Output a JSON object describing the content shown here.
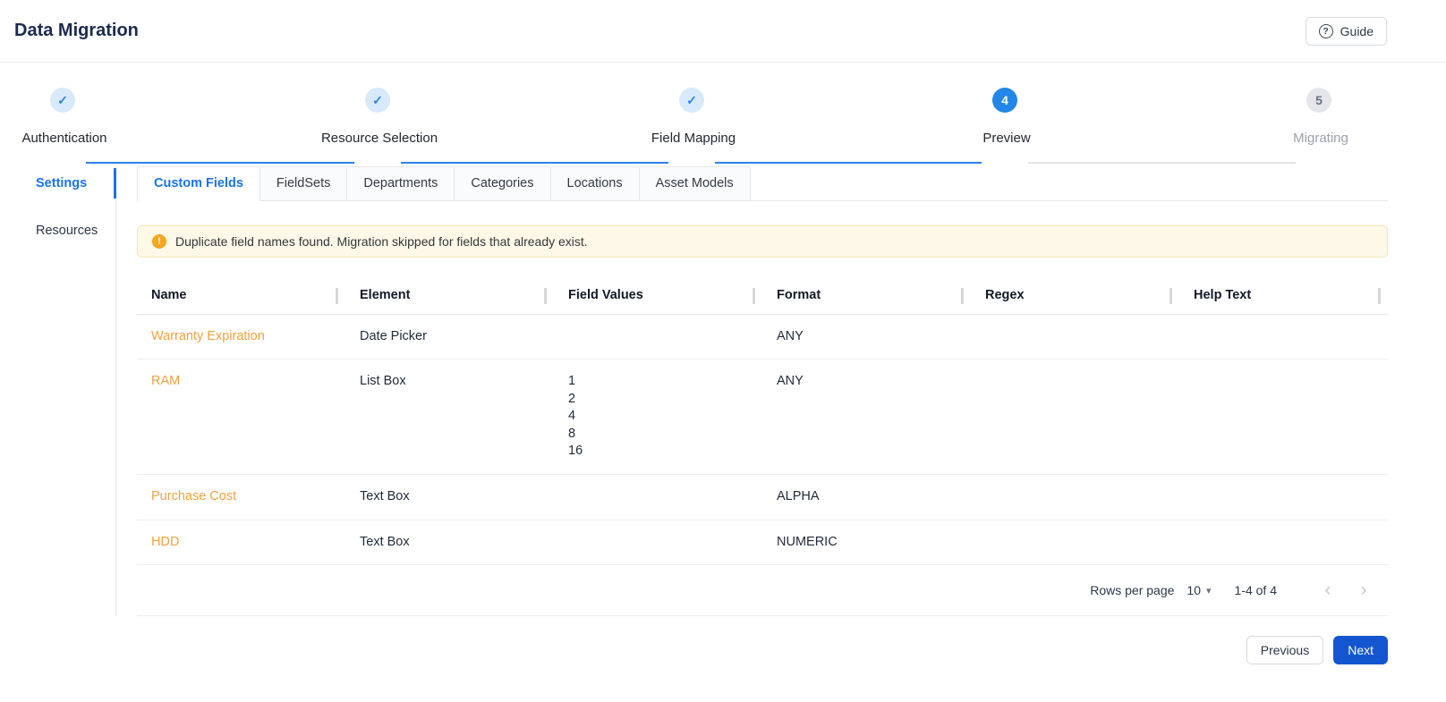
{
  "header": {
    "title": "Data Migration",
    "guide_label": "Guide"
  },
  "stepper": {
    "steps": [
      {
        "label": "Authentication",
        "state": "complete",
        "marker": "✓"
      },
      {
        "label": "Resource Selection",
        "state": "complete",
        "marker": "✓"
      },
      {
        "label": "Field Mapping",
        "state": "complete",
        "marker": "✓"
      },
      {
        "label": "Preview",
        "state": "active",
        "marker": "4"
      },
      {
        "label": "Migrating",
        "state": "pending",
        "marker": "5"
      }
    ]
  },
  "sidebar": {
    "items": [
      {
        "label": "Settings",
        "active": true
      },
      {
        "label": "Resources",
        "active": false
      }
    ]
  },
  "tabs": [
    {
      "label": "Custom Fields",
      "active": true
    },
    {
      "label": "FieldSets",
      "active": false
    },
    {
      "label": "Departments",
      "active": false
    },
    {
      "label": "Categories",
      "active": false
    },
    {
      "label": "Locations",
      "active": false
    },
    {
      "label": "Asset Models",
      "active": false
    }
  ],
  "alert": {
    "message": "Duplicate field names found. Migration skipped for fields that already exist."
  },
  "table": {
    "columns": [
      "Name",
      "Element",
      "Field Values",
      "Format",
      "Regex",
      "Help Text"
    ],
    "rows": [
      {
        "name": "Warranty Expiration",
        "element": "Date Picker",
        "field_values": "",
        "format": "ANY",
        "regex": "",
        "help_text": ""
      },
      {
        "name": "RAM",
        "element": "List Box",
        "field_values": "1\n2\n4\n8\n16",
        "format": "ANY",
        "regex": "",
        "help_text": ""
      },
      {
        "name": "Purchase Cost",
        "element": "Text Box",
        "field_values": "",
        "format": "ALPHA",
        "regex": "",
        "help_text": ""
      },
      {
        "name": "HDD",
        "element": "Text Box",
        "field_values": "",
        "format": "NUMERIC",
        "regex": "",
        "help_text": ""
      }
    ],
    "pagination": {
      "rows_per_page_label": "Rows per page",
      "rows_per_page_value": "10",
      "range": "1-4 of 4",
      "prev_icon": "‹",
      "next_icon": "›",
      "caret_icon": "▾"
    }
  },
  "footer": {
    "previous_label": "Previous",
    "next_label": "Next"
  },
  "colors": {
    "primary_blue": "#1a73e8",
    "active_step_blue": "#2186e8",
    "completed_step_bg": "#d7e9fb",
    "link_orange": "#f0a13c",
    "alert_bg": "#fdf8e7",
    "alert_border": "#f3e5b5",
    "warning_icon": "#f5a623",
    "next_button_blue": "#1456d0"
  }
}
